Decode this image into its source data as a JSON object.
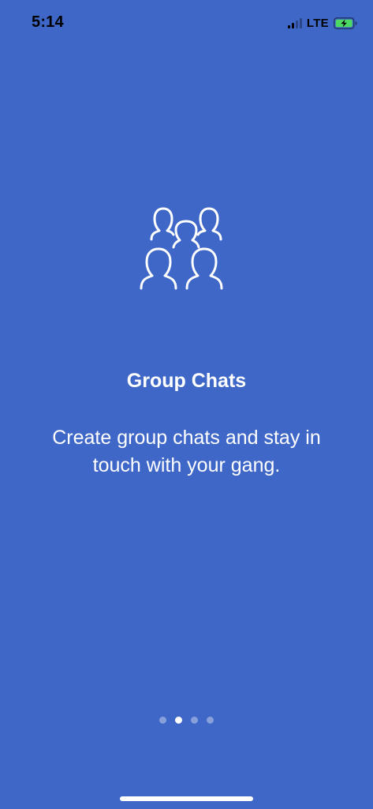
{
  "status_bar": {
    "time": "5:14",
    "network": "LTE",
    "signal_icon": "signal-bars-icon",
    "battery_icon": "battery-charging-icon",
    "battery_color": "#4cd964"
  },
  "onboarding": {
    "illustration_icon": "group-people-icon",
    "title": "Group Chats",
    "description": "Create group chats and stay in touch with your gang.",
    "page_count": 4,
    "active_page": 2
  },
  "colors": {
    "background": "#3e67c7",
    "text": "#ffffff"
  }
}
